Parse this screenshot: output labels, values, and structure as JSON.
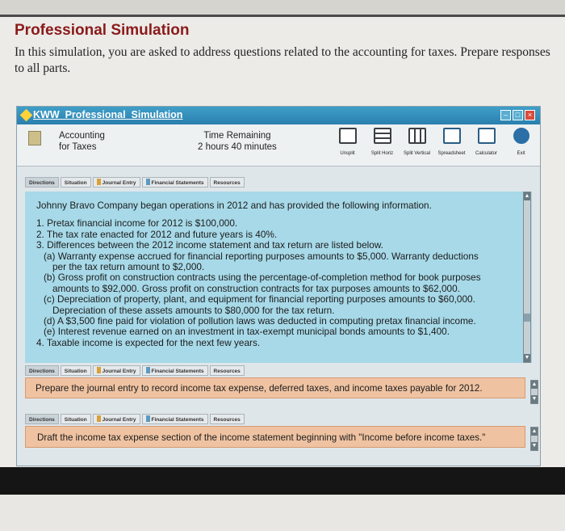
{
  "page": {
    "title": "Professional Simulation",
    "intro": "In this simulation, you are asked to address questions related to the accounting for taxes. Prepare responses to all parts."
  },
  "window": {
    "title": "KWW_Professional_Simulation",
    "controls": [
      "–",
      "□",
      "×"
    ]
  },
  "info": {
    "topic_line1": "Accounting",
    "topic_line2": "for Taxes",
    "time_label": "Time Remaining",
    "time_value": "2 hours 40 minutes"
  },
  "toolbar": {
    "items": [
      {
        "label": "Unsplit",
        "icon": "unsplit-icon"
      },
      {
        "label": "Split Horiz",
        "icon": "split-horizontal-icon"
      },
      {
        "label": "Split Vertical",
        "icon": "split-vertical-icon"
      },
      {
        "label": "Spreadsheet",
        "icon": "spreadsheet-icon"
      },
      {
        "label": "Calculator",
        "icon": "calculator-icon"
      },
      {
        "label": "Exit",
        "icon": "exit-icon"
      }
    ]
  },
  "tabs": [
    "Directions",
    "Situation",
    "Journal Entry",
    "Financial Statements",
    "Resources"
  ],
  "situation": {
    "intro": "Johnny Bravo Company began operations in 2012 and has provided the following information.",
    "items": [
      "1. Pretax financial income for 2012 is $100,000.",
      "2. The tax rate enacted for 2012 and future years is 40%.",
      "3. Differences between the 2012 income statement and tax return are listed below."
    ],
    "subitems": [
      {
        "line1": "(a) Warranty expense accrued for financial reporting purposes amounts to $5,000. Warranty deductions",
        "line2": "per the tax return amount to $2,000."
      },
      {
        "line1": "(b) Gross profit on construction contracts using the percentage-of-completion method for book purposes",
        "line2": "amounts to $92,000. Gross profit on construction contracts for tax purposes amounts to $62,000."
      },
      {
        "line1": "(c) Depreciation of property, plant, and equipment for financial reporting purposes amounts to $60,000.",
        "line2": "Depreciation of these assets amounts to $80,000 for the tax return."
      },
      {
        "line1": "(d) A $3,500 fine paid for violation of pollution laws was deducted in computing pretax financial income.",
        "line2": ""
      },
      {
        "line1": "(e) Interest revenue earned on an investment in tax-exempt municipal bonds amounts to $1,400.",
        "line2": ""
      }
    ],
    "item4": "4. Taxable income is expected for the next few years."
  },
  "questions": {
    "journal": "Prepare the journal entry to record income tax expense, deferred taxes, and income taxes payable for 2012.",
    "statement": "Draft the income tax expense section of the income statement beginning with \"Income before income taxes.\""
  },
  "colors": {
    "title": "#8b1a1a",
    "titlebar": "#2a7fae",
    "situation_bg": "#a7d9e8",
    "question_bg": "#efc3a2"
  }
}
